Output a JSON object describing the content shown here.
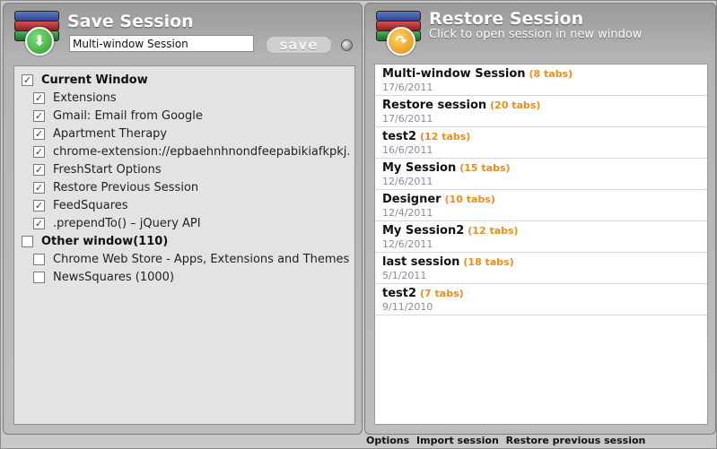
{
  "save_panel": {
    "title": "Save Session",
    "session_name_value": "Multi-window Session",
    "save_label": "save"
  },
  "tabs_tree": {
    "groups": [
      {
        "label": "Current Window",
        "checked": true,
        "tabs": [
          {
            "label": "Extensions",
            "checked": true
          },
          {
            "label": "Gmail: Email from Google",
            "checked": true
          },
          {
            "label": "Apartment Therapy",
            "checked": true
          },
          {
            "label": "chrome-extension://epbaehnhnondfeepabikiafkpkj...",
            "checked": true
          },
          {
            "label": "FreshStart Options",
            "checked": true
          },
          {
            "label": "Restore Previous Session",
            "checked": true
          },
          {
            "label": "FeedSquares",
            "checked": true
          },
          {
            "label": ".prependTo() – jQuery API",
            "checked": true
          }
        ]
      },
      {
        "label": "Other window(110)",
        "checked": false,
        "tabs": [
          {
            "label": "Chrome Web Store - Apps, Extensions and Themes",
            "checked": false
          },
          {
            "label": "NewsSquares (1000)",
            "checked": false
          }
        ]
      }
    ]
  },
  "restore_panel": {
    "title": "Restore Session",
    "subtitle": "Click to open session in new window",
    "sessions": [
      {
        "name": "Multi-window Session",
        "count": "(8 tabs)",
        "date": "17/6/2011"
      },
      {
        "name": "Restore session",
        "count": "(20 tabs)",
        "date": "17/6/2011"
      },
      {
        "name": "test2",
        "count": "(12 tabs)",
        "date": "16/6/2011"
      },
      {
        "name": "My Session",
        "count": "(15 tabs)",
        "date": "12/6/2011"
      },
      {
        "name": "Designer",
        "count": "(10 tabs)",
        "date": "12/4/2011"
      },
      {
        "name": "My Session2",
        "count": "(12 tabs)",
        "date": "12/6/2011"
      },
      {
        "name": "last session",
        "count": "(18 tabs)",
        "date": "5/1/2011"
      },
      {
        "name": "test2",
        "count": "(7 tabs)",
        "date": "9/11/2010"
      }
    ]
  },
  "footer": {
    "options": "Options",
    "import": "Import session",
    "restore_previous": "Restore previous session"
  },
  "icons": {
    "save_badge": "download-arrow-icon",
    "restore_badge": "restore-arrow-icon",
    "checkmark": "✓"
  },
  "colors": {
    "tab_count": "#f08c1a",
    "date": "#8a8aa8",
    "panel_bg": "#b4b4b4"
  }
}
